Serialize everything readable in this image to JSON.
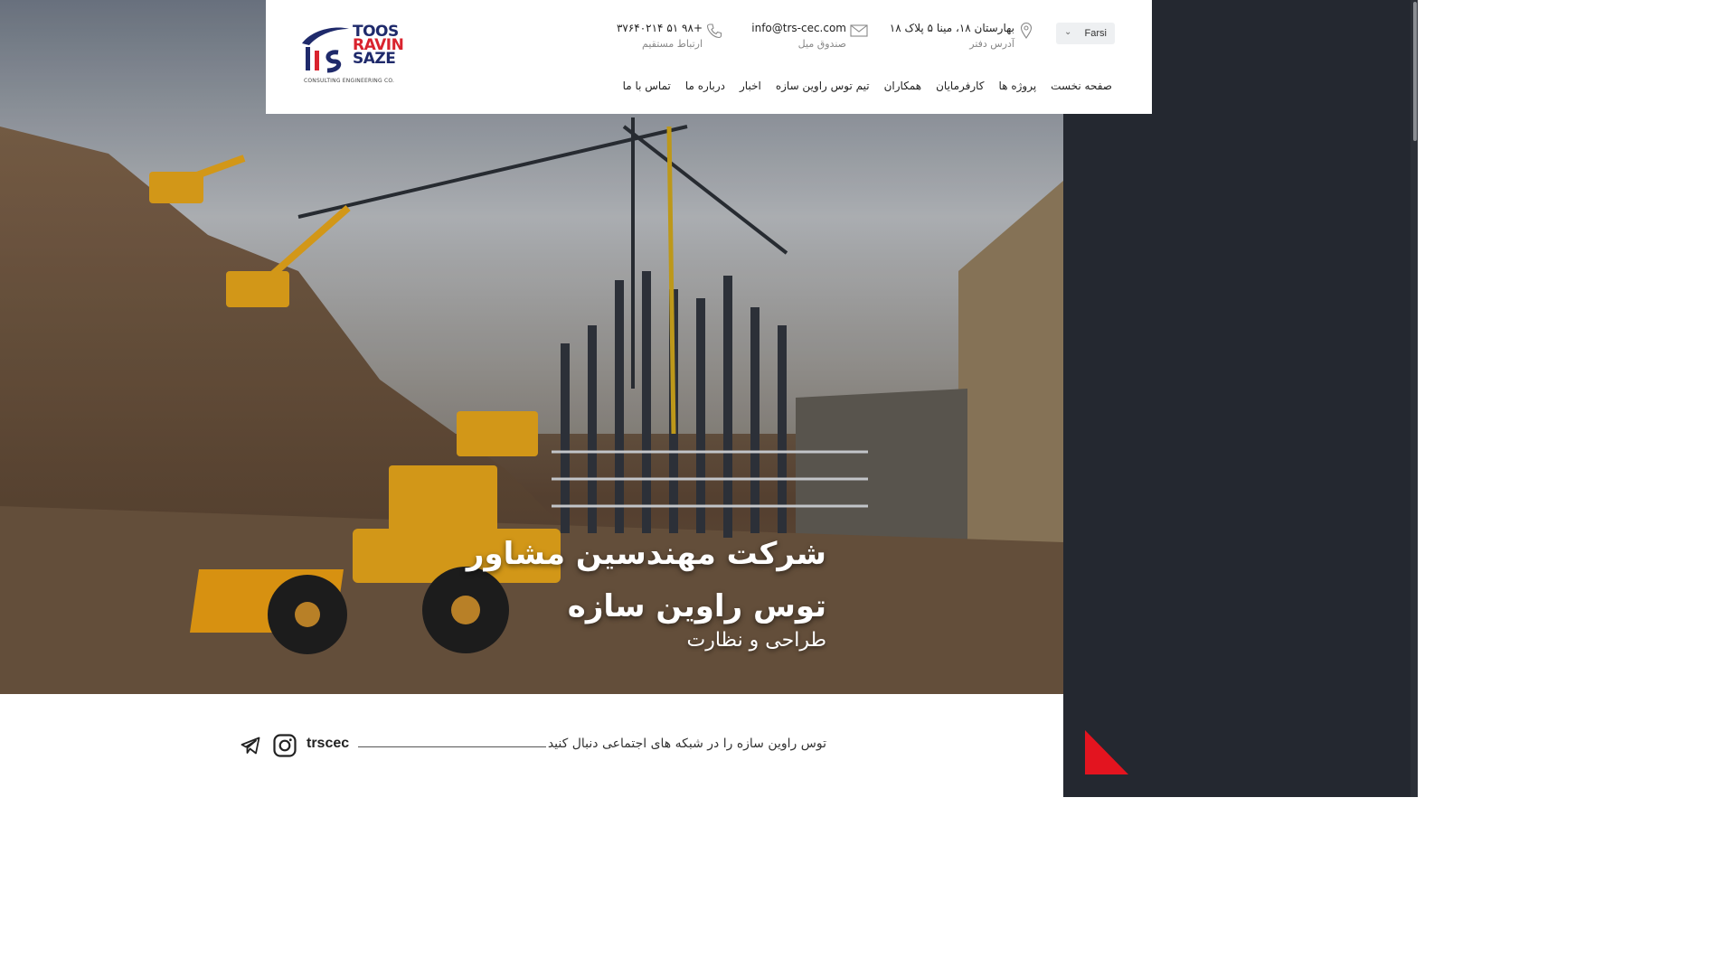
{
  "brand": {
    "logo_line1": "TOOS",
    "logo_line2": "RAVIN",
    "logo_line3": "SAZE",
    "logo_tagline": "CONSULTING ENGINEERING CO.",
    "navy": "#1f2a6b",
    "red": "#d9232e"
  },
  "header": {
    "address": {
      "value": "بهارستان ۱۸، مینا ۵ پلاک ۱۸",
      "label": "آدرس دفتر",
      "icon": "location-pin-icon"
    },
    "email": {
      "value": "info@trs-cec.com",
      "label": "صندوق میل",
      "icon": "envelope-icon"
    },
    "phone": {
      "value": "+۹۸ ۵۱ ۳۷۶۴۰۲۱۴",
      "label": "ارتباط مستقیم",
      "icon": "phone-icon"
    },
    "language": "Farsi"
  },
  "nav": {
    "items": [
      {
        "label": "صفحه نخست"
      },
      {
        "label": "پروژه ها"
      },
      {
        "label": "کارفرمایان"
      },
      {
        "label": "همکاران"
      },
      {
        "label": "تیم توس راوین سازه"
      },
      {
        "label": "اخبار"
      },
      {
        "label": "درباره ما"
      },
      {
        "label": "تماس با ما"
      }
    ]
  },
  "hero": {
    "title_line1": "شرکت مهندسین مشاور",
    "title_line2": "توس راوین سازه",
    "subtitle": "طراحی و نظارت"
  },
  "social": {
    "follow_text": "توس راوین سازه را در شبکه های اجتماعی دنبال کنید",
    "handle": "trscec",
    "icons": [
      "instagram-icon",
      "telegram-icon"
    ]
  },
  "accent": "#e3141f",
  "panel_color": "#242830"
}
